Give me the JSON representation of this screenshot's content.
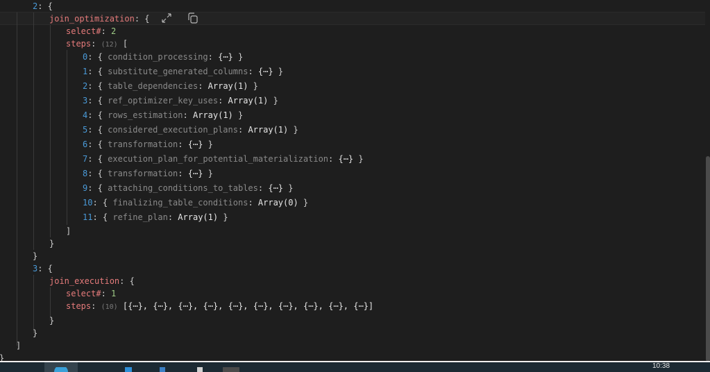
{
  "tree": {
    "item2_index": "2",
    "join_optimization_key": "join_optimization",
    "select_key": "select#",
    "select_value_2": "2",
    "steps_key": "steps",
    "steps_count_12": "(12)",
    "steps": [
      {
        "index": "0",
        "key": "condition_processing",
        "value": "{⋯}"
      },
      {
        "index": "1",
        "key": "substitute_generated_columns",
        "value": "{⋯}"
      },
      {
        "index": "2",
        "key": "table_dependencies",
        "value": "Array(1)"
      },
      {
        "index": "3",
        "key": "ref_optimizer_key_uses",
        "value": "Array(1)"
      },
      {
        "index": "4",
        "key": "rows_estimation",
        "value": "Array(1)"
      },
      {
        "index": "5",
        "key": "considered_execution_plans",
        "value": "Array(1)"
      },
      {
        "index": "6",
        "key": "transformation",
        "value": "{⋯}"
      },
      {
        "index": "7",
        "key": "execution_plan_for_potential_materialization",
        "value": "{⋯}"
      },
      {
        "index": "8",
        "key": "transformation",
        "value": "{⋯}"
      },
      {
        "index": "9",
        "key": "attaching_conditions_to_tables",
        "value": "{⋯}"
      },
      {
        "index": "10",
        "key": "finalizing_table_conditions",
        "value": "Array(0)"
      },
      {
        "index": "11",
        "key": "refine_plan",
        "value": "Array(1)"
      }
    ],
    "item3_index": "3",
    "join_execution_key": "join_execution",
    "select_value_1": "1",
    "steps_count_10": "(10)",
    "collapsed_steps": "[{⋯}, {⋯}, {⋯}, {⋯}, {⋯}, {⋯}, {⋯}, {⋯}, {⋯}, {⋯}]"
  },
  "icons": {
    "expand": "expand-icon",
    "copy": "copy-icon"
  },
  "taskbar": {
    "clock": "10:38"
  }
}
